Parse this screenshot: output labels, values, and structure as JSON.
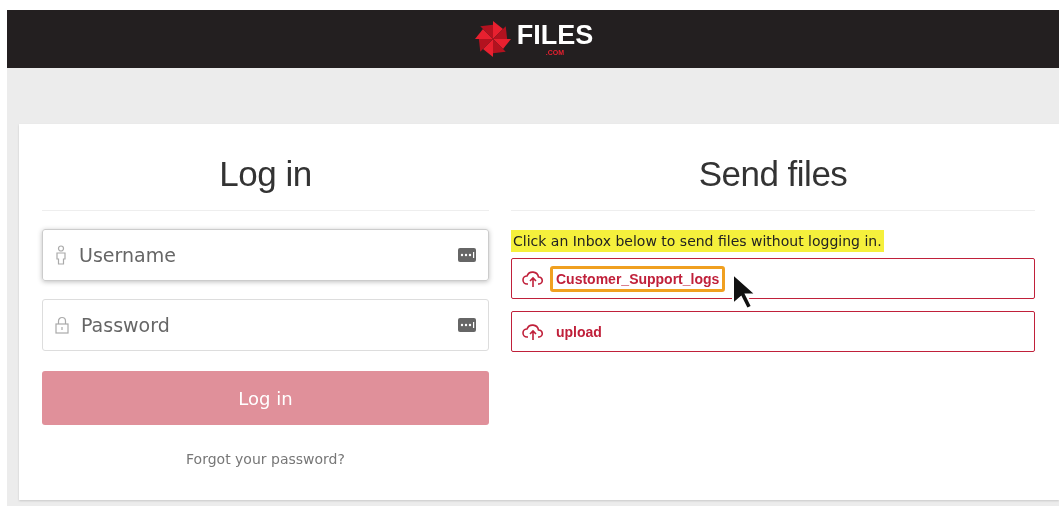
{
  "header": {
    "logo_text": "FILES",
    "logo_suffix": ".COM"
  },
  "login": {
    "title": "Log in",
    "fields": [
      {
        "kind": "user",
        "placeholder": "Username",
        "focused": true
      },
      {
        "kind": "lock",
        "placeholder": "Password",
        "focused": false
      }
    ],
    "button": "Log in",
    "forgot_link": "Forgot your password?"
  },
  "send": {
    "title": "Send files",
    "hint": "Click an Inbox below to send files without logging in.",
    "inboxes": [
      {
        "name": "Customer_Support_logs",
        "highlighted": true
      },
      {
        "name": "upload",
        "highlighted": false
      }
    ]
  }
}
